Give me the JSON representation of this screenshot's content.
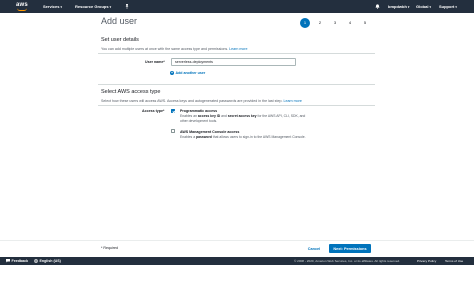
{
  "topnav": {
    "logo_text": "aws",
    "services_label": "Services",
    "resource_groups_label": "Resource Groups",
    "account_label": "bmpdwbh",
    "region_label": "Global",
    "support_label": "Support",
    "caret": "▾",
    "icons": [
      "aws-logo",
      "pin-icon",
      "bell-icon"
    ]
  },
  "page_title": "Add user",
  "steps": [
    "1",
    "2",
    "3",
    "4",
    "5"
  ],
  "active_step": "1",
  "user_details": {
    "title": "Set user details",
    "desc_text": "You can add multiple users at once with the same access type and permissions.",
    "desc_link": "Learn more",
    "user_name_label": "User name*",
    "user_name_value": "serverless-deployments",
    "add_another_label": "Add another user",
    "add_icon": "+"
  },
  "access_type": {
    "title": "Select AWS access type",
    "desc_text": "Select how these users will access AWS. Access keys and autogenerated passwords are provided in the last step.",
    "desc_link": "Learn more",
    "label": "Access type*",
    "programmatic": {
      "checked": true,
      "title": "Programmatic access",
      "line1_prefix": "Enables an ",
      "line1_bold1": "access key ID",
      "line1_mid": " and ",
      "line1_bold2": "secret access key",
      "line1_suffix": " for the AWS API, CLI, SDK, and",
      "line2": "other development tools."
    },
    "console": {
      "checked": false,
      "title": "AWS Management Console access",
      "line1_prefix": "Enables a ",
      "line1_bold": "password",
      "line1_suffix": " that allows users to sign-in to the AWS Management Console."
    }
  },
  "footer_actions": {
    "required_note": "* Required",
    "cancel_label": "Cancel",
    "next_label": "Next: Permissions"
  },
  "footer": {
    "feedback_label": "Feedback",
    "language_label": "English (US)",
    "copyright": "© 2008 - 2020, Amazon Web Services, Inc. or its affiliates. All rights reserved.",
    "privacy_label": "Privacy Policy",
    "terms_label": "Terms of Use"
  },
  "colors": {
    "nav_bg": "#232f3e",
    "accent": "#0073bb",
    "logo_smile": "#ff9900"
  }
}
